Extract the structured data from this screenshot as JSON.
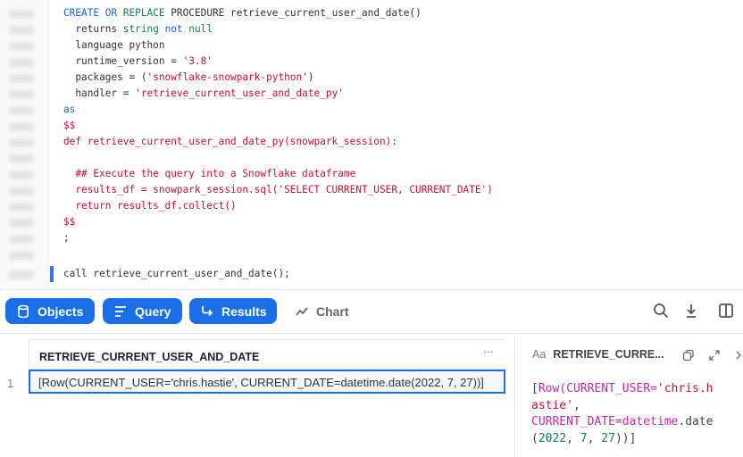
{
  "editor": {
    "lines": [
      [
        {
          "t": "CREATE ",
          "c": "kb"
        },
        {
          "t": "OR ",
          "c": "kb"
        },
        {
          "t": "REPLACE ",
          "c": "kg"
        },
        {
          "t": "PROCEDURE retrieve_current_user_and_date()",
          "c": ""
        }
      ],
      [
        {
          "t": "  returns ",
          "c": ""
        },
        {
          "t": "string ",
          "c": "kg"
        },
        {
          "t": "not ",
          "c": "kb"
        },
        {
          "t": "null",
          "c": "kg"
        }
      ],
      [
        {
          "t": "  language python",
          "c": ""
        }
      ],
      [
        {
          "t": "  runtime_version = ",
          "c": ""
        },
        {
          "t": "'3.8'",
          "c": "st"
        }
      ],
      [
        {
          "t": "  packages = (",
          "c": ""
        },
        {
          "t": "'snowflake-snowpark-python'",
          "c": "st"
        },
        {
          "t": ")",
          "c": ""
        }
      ],
      [
        {
          "t": "  handler = ",
          "c": ""
        },
        {
          "t": "'retrieve_current_user_and_date_py'",
          "c": "st"
        }
      ],
      [
        {
          "t": "as",
          "c": "kb"
        }
      ],
      [
        {
          "t": "$$",
          "c": "st"
        }
      ],
      [
        {
          "t": "def retrieve_current_user_and_date_py(snowpark_session):",
          "c": "st"
        }
      ],
      [
        {
          "t": "",
          "c": ""
        }
      ],
      [
        {
          "t": "  ## Execute the query into a Snowflake dataframe",
          "c": "st"
        }
      ],
      [
        {
          "t": "  results_df = snowpark_session.sql('SELECT CURRENT_USER, CURRENT_DATE')",
          "c": "st"
        }
      ],
      [
        {
          "t": "  return results_df.collect()",
          "c": "st"
        }
      ],
      [
        {
          "t": "$$",
          "c": "st"
        }
      ],
      [
        {
          "t": ";",
          "c": ""
        }
      ],
      [
        {
          "t": "",
          "c": ""
        }
      ],
      [
        {
          "t": "call retrieve_current_user_and_date();",
          "c": ""
        }
      ]
    ]
  },
  "toolbar": {
    "objects": "Objects",
    "query": "Query",
    "results": "Results",
    "chart": "Chart",
    "accent": "#1a6ee6"
  },
  "grid": {
    "column": "RETRIEVE_CURRENT_USER_AND_DATE",
    "more": "···",
    "rows": [
      {
        "num": "1",
        "value": "[Row(CURRENT_USER='chris.hastie', CURRENT_DATE=datetime.date(2022, 7, 27))]"
      }
    ]
  },
  "panel": {
    "type_label": "Aa",
    "title": "RETRIEVE_CURRE...",
    "value_parts": {
      "p1": "[",
      "p2": "Row(CURRENT_USER=",
      "p3": "'chris.h\nastie'",
      "p4": ",\n",
      "p5": "CURRENT_DATE=datetime",
      ".date": ".date\n(",
      "y": "2022",
      ", ": ", ",
      "m": "7",
      "d": "27",
      "end": "))]",
      "sep": ", "
    }
  }
}
